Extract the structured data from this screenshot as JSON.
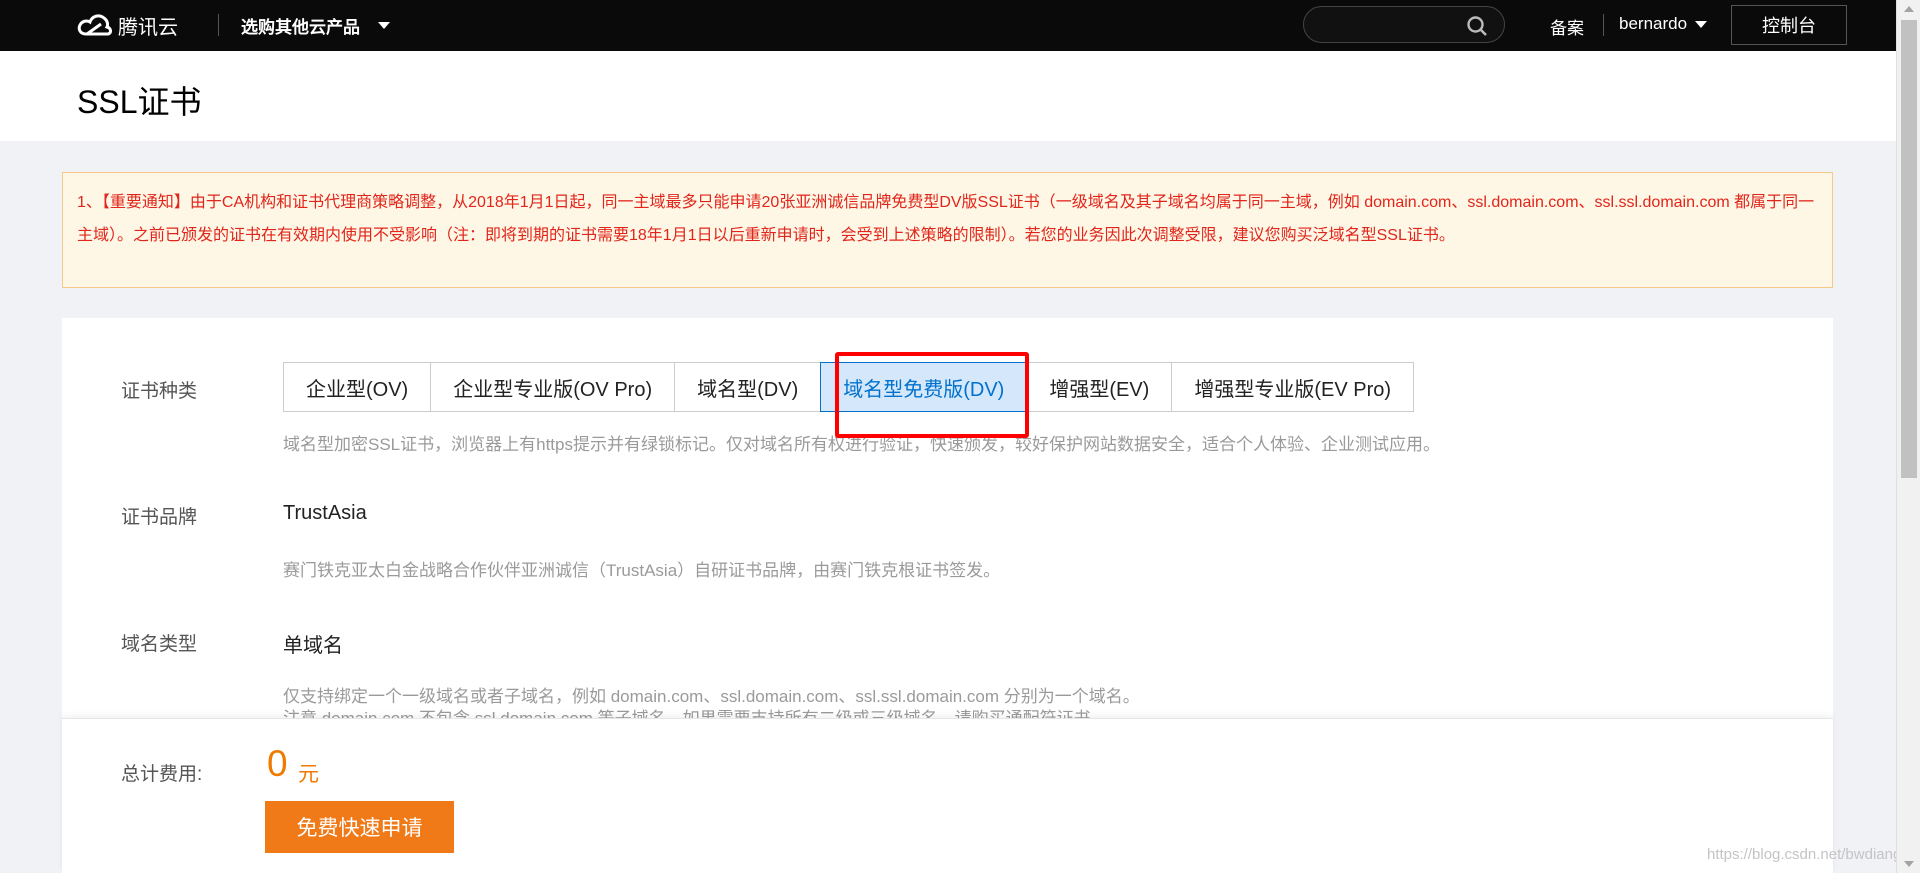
{
  "topbar": {
    "logo_text": "腾讯云",
    "product_menu": "选购其他云产品",
    "search_placeholder": "",
    "beian": "备案",
    "username": "bernardo",
    "console_label": "控制台"
  },
  "page": {
    "title": "SSL证书"
  },
  "notice": {
    "text": "1、【重要通知】由于CA机构和证书代理商策略调整，从2018年1月1日起，同一主域最多只能申请20张亚洲诚信品牌免费型DV版SSL证书（一级域名及其子域名均属于同一主域，例如 domain.com、ssl.domain.com、ssl.ssl.domain.com 都属于同一主域）。之前已颁发的证书在有效期内使用不受影响（注：即将到期的证书需要18年1月1日以后重新申请时，会受到上述策略的限制）。若您的业务因此次调整受限，建议您购买泛域名型SSL证书。"
  },
  "cert_type": {
    "label": "证书种类",
    "tabs": [
      {
        "label": "企业型(OV)"
      },
      {
        "label": "企业型专业版(OV Pro)"
      },
      {
        "label": "域名型(DV)"
      },
      {
        "label": "域名型免费版(DV)",
        "active": true
      },
      {
        "label": "增强型(EV)"
      },
      {
        "label": "增强型专业版(EV Pro)"
      }
    ],
    "description": "域名型加密SSL证书，浏览器上有https提示并有绿锁标记。仅对域名所有权进行验证，快速颁发，较好保护网站数据安全，适合个人体验、企业测试应用。"
  },
  "cert_brand": {
    "label": "证书品牌",
    "value": "TrustAsia",
    "description": "赛门铁克亚太白金战略合作伙伴亚洲诚信（TrustAsia）自研证书品牌，由赛门铁克根证书签发。"
  },
  "domain_type": {
    "label": "域名类型",
    "value": "单域名",
    "description_line1": "仅支持绑定一个一级域名或者子域名，例如 domain.com、ssl.domain.com、ssl.ssl.domain.com 分别为一个域名。",
    "description_line2": "注意 domain.com 不包含 ssl.domain.com 等子域名，如果需要支持所有二级或三级域名，请购买通配符证书。"
  },
  "footer": {
    "total_label": "总计费用:",
    "amount": "0",
    "unit": "元",
    "apply_button": "免费快速申请"
  },
  "watermark": "https://blog.csdn.net/bwdiang",
  "colors": {
    "topbar_bg": "#0a0a0a",
    "notice_text": "#e1251b",
    "active_tab": "#0071ce",
    "price": "#f07a00",
    "apply_button": "#f07918",
    "highlight": "#ff0000"
  }
}
